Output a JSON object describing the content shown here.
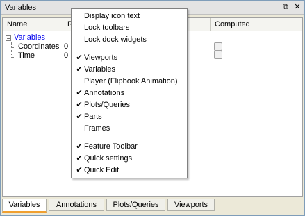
{
  "window": {
    "title": "Variables",
    "float_icon": "⧉",
    "close_icon": "✕"
  },
  "table": {
    "columns": [
      "Name",
      "R",
      "",
      "Computed"
    ],
    "tree": {
      "root": "Variables",
      "expander": "−",
      "children": [
        "Coordinates",
        "Time"
      ],
      "child_values": [
        "0",
        "0"
      ]
    }
  },
  "context_menu": {
    "check_glyph": "✔",
    "groups": [
      [
        {
          "label": "Display icon text",
          "checked": false
        },
        {
          "label": "Lock toolbars",
          "checked": false
        },
        {
          "label": "Lock dock widgets",
          "checked": false
        }
      ],
      [
        {
          "label": "Viewports",
          "checked": true
        },
        {
          "label": "Variables",
          "checked": true
        },
        {
          "label": "Player (Flipbook Animation)",
          "checked": false
        },
        {
          "label": "Annotations",
          "checked": true
        },
        {
          "label": "Plots/Queries",
          "checked": true
        },
        {
          "label": "Parts",
          "checked": true
        },
        {
          "label": "Frames",
          "checked": false
        }
      ],
      [
        {
          "label": "Feature Toolbar",
          "checked": true
        },
        {
          "label": "Quick settings",
          "checked": true
        },
        {
          "label": "Quick Edit",
          "checked": true
        }
      ]
    ]
  },
  "tabs": [
    "Variables",
    "Annotations",
    "Plots/Queries",
    "Viewports"
  ],
  "active_tab": "Variables"
}
